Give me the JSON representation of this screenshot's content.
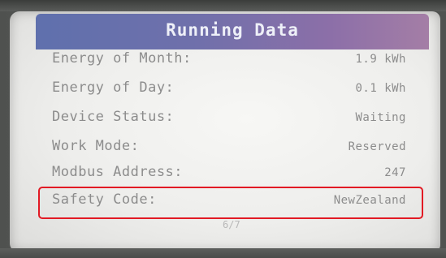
{
  "screen": {
    "title": "Running Data",
    "rows": [
      {
        "label": "Energy of Month:",
        "value": "1.9 kWh"
      },
      {
        "label": "Energy of Day:",
        "value": "0.1 kWh"
      },
      {
        "label": "Device Status:",
        "value": "Waiting"
      },
      {
        "label": "Work Mode:",
        "value": "Reserved"
      },
      {
        "label": "Modbus Address:",
        "value": "247"
      },
      {
        "label": "Safety Code:",
        "value": "NewZealand"
      }
    ],
    "page_indicator": "6/7",
    "highlight_color": "#e21a24",
    "title_bar_colors": [
      "#5f70ad",
      "#a47ea6"
    ]
  }
}
